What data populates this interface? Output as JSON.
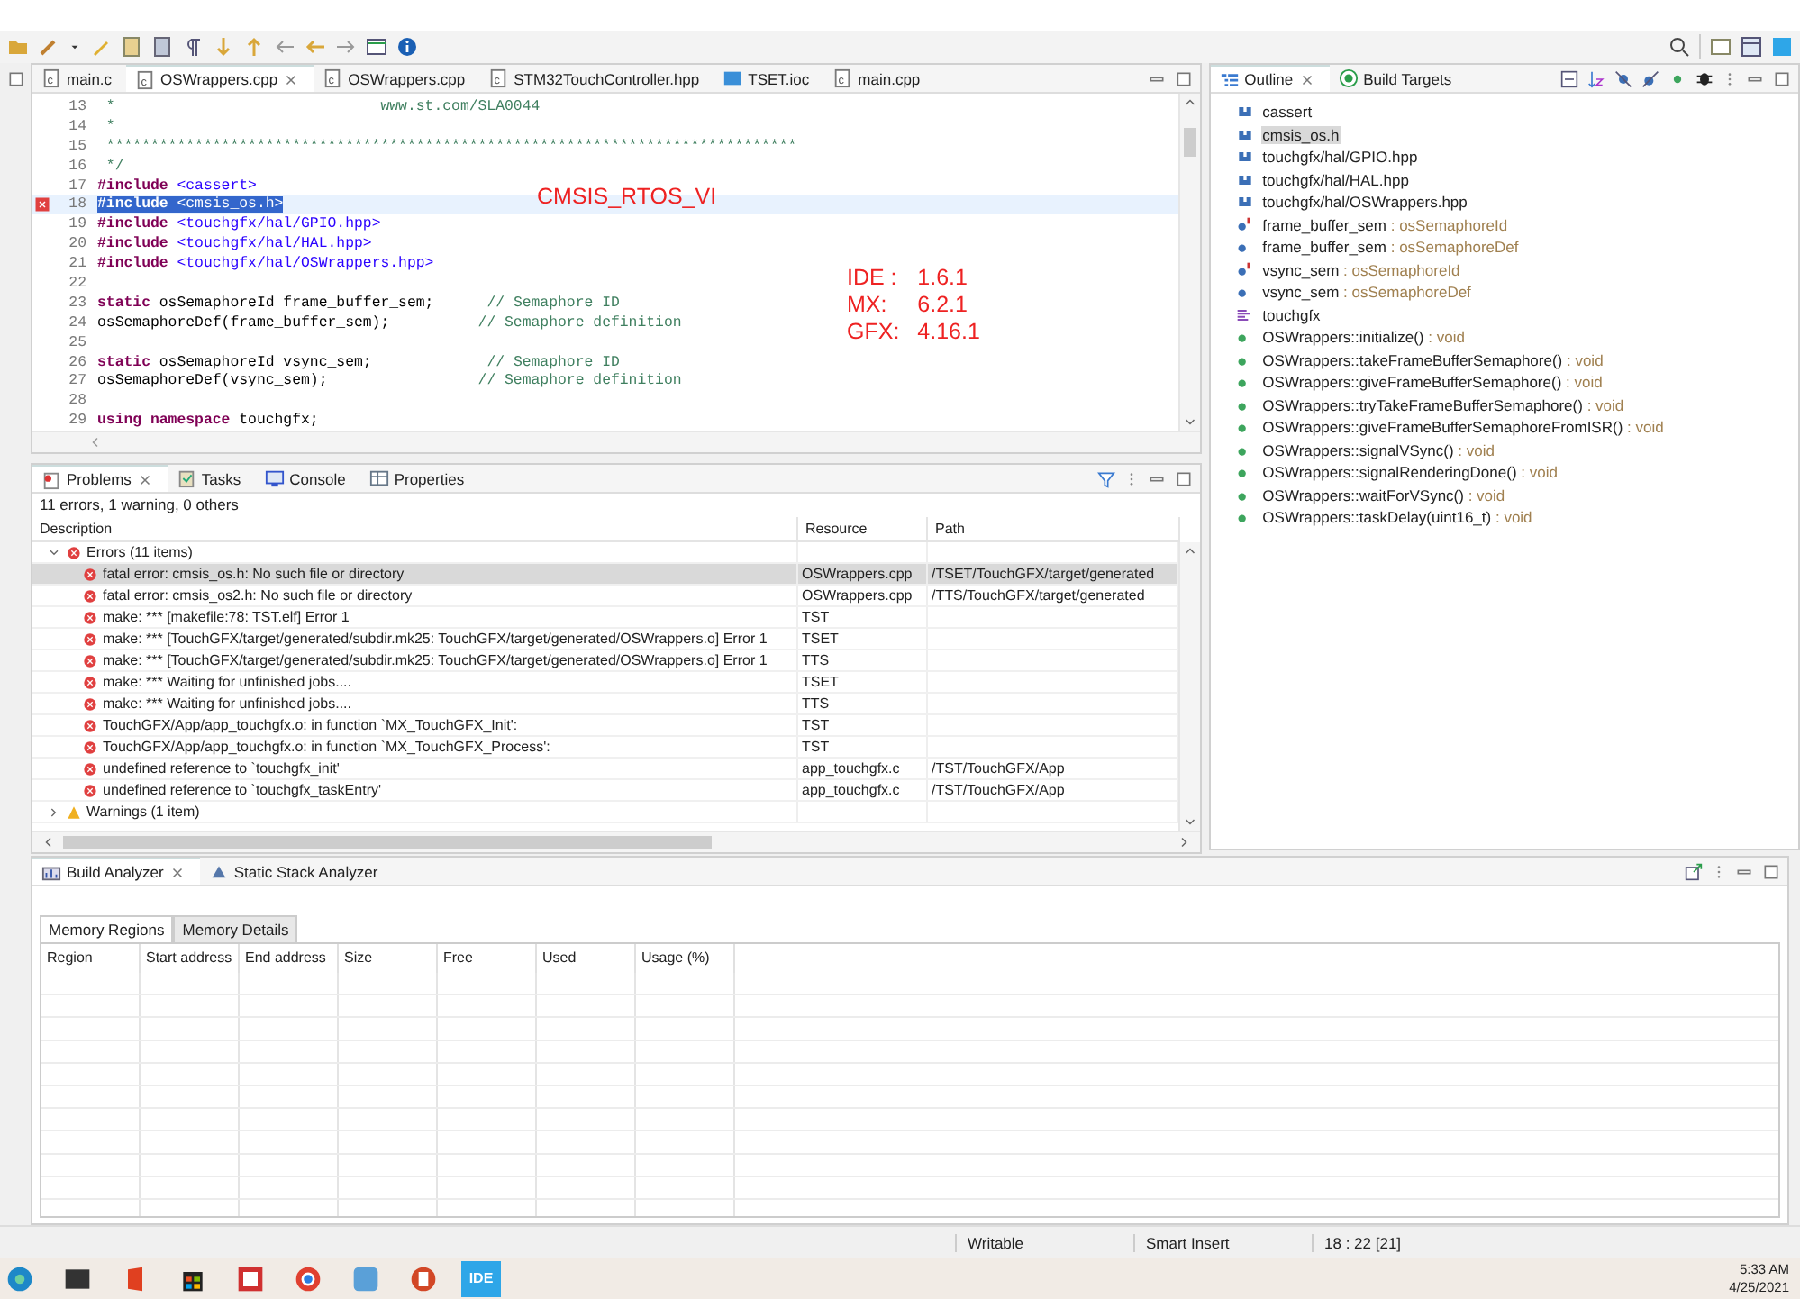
{
  "editor": {
    "tabs": [
      {
        "label": "main.c",
        "selected": false,
        "kind": "c"
      },
      {
        "label": "OSWrappers.cpp",
        "selected": true,
        "kind": "c"
      },
      {
        "label": "OSWrappers.cpp",
        "selected": false,
        "kind": "c"
      },
      {
        "label": "STM32TouchController.hpp",
        "selected": false,
        "kind": "c"
      },
      {
        "label": "TSET.ioc",
        "selected": false,
        "kind": "mx"
      },
      {
        "label": "main.cpp",
        "selected": false,
        "kind": "c"
      }
    ],
    "lines": [
      {
        "number": "13",
        "current": false,
        "error": false,
        "selected": false,
        "tokens": [
          {
            "kind": "comment",
            "text": " *                              www.st.com/SLA0044"
          }
        ]
      },
      {
        "number": "14",
        "current": false,
        "error": false,
        "selected": false,
        "tokens": [
          {
            "kind": "comment",
            "text": " *"
          }
        ]
      },
      {
        "number": "15",
        "current": false,
        "error": false,
        "selected": false,
        "tokens": [
          {
            "kind": "comment",
            "text": " ******************************************************************************"
          }
        ]
      },
      {
        "number": "16",
        "current": false,
        "error": false,
        "selected": false,
        "tokens": [
          {
            "kind": "comment",
            "text": " */"
          }
        ]
      },
      {
        "number": "17",
        "current": false,
        "error": false,
        "selected": false,
        "tokens": [
          {
            "kind": "keyword",
            "text": "#include"
          },
          {
            "kind": "string",
            "text": " <cassert>"
          }
        ]
      },
      {
        "number": "18",
        "current": true,
        "error": true,
        "selected": true,
        "tokens": [
          {
            "kind": "keyword",
            "text": "#include"
          },
          {
            "kind": "string",
            "text": " <cmsis_os.h>"
          }
        ]
      },
      {
        "number": "19",
        "current": false,
        "error": false,
        "selected": false,
        "tokens": [
          {
            "kind": "keyword",
            "text": "#include"
          },
          {
            "kind": "string",
            "text": " <touchgfx/hal/GPIO.hpp>"
          }
        ]
      },
      {
        "number": "20",
        "current": false,
        "error": false,
        "selected": false,
        "tokens": [
          {
            "kind": "keyword",
            "text": "#include"
          },
          {
            "kind": "string",
            "text": " <touchgfx/hal/HAL.hpp>"
          }
        ]
      },
      {
        "number": "21",
        "current": false,
        "error": false,
        "selected": false,
        "tokens": [
          {
            "kind": "keyword",
            "text": "#include"
          },
          {
            "kind": "string",
            "text": " <touchgfx/hal/OSWrappers.hpp>"
          }
        ]
      },
      {
        "number": "22",
        "current": false,
        "error": false
      },
      {
        "number": "23",
        "current": false,
        "error": false,
        "selected": false,
        "tokens": [
          {
            "kind": "keyword",
            "text": "static"
          },
          {
            "kind": "plain",
            "text": " osSemaphoreId frame_buffer_sem;      "
          },
          {
            "kind": "comment",
            "text": "// Semaphore ID"
          }
        ]
      },
      {
        "number": "24",
        "current": false,
        "error": false,
        "selected": false,
        "tokens": [
          {
            "kind": "plain",
            "text": "osSemaphoreDef(frame_buffer_sem);          "
          },
          {
            "kind": "comment",
            "text": "// Semaphore definition"
          }
        ]
      },
      {
        "number": "25",
        "current": false,
        "error": false
      },
      {
        "number": "26",
        "current": false,
        "error": false,
        "selected": false,
        "tokens": [
          {
            "kind": "keyword",
            "text": "static"
          },
          {
            "kind": "plain",
            "text": " osSemaphoreId vsync_sem;             "
          },
          {
            "kind": "comment",
            "text": "// Semaphore ID"
          }
        ]
      },
      {
        "number": "27",
        "current": false,
        "error": false,
        "selected": false,
        "tokens": [
          {
            "kind": "plain",
            "text": "osSemaphoreDef(vsync_sem);                 "
          },
          {
            "kind": "comment",
            "text": "// Semaphore definition"
          }
        ]
      },
      {
        "number": "28",
        "current": false,
        "error": false
      },
      {
        "number": "29",
        "current": false,
        "error": false,
        "selected": false,
        "tokens": [
          {
            "kind": "keyword",
            "text": "using namespace"
          },
          {
            "kind": "plain",
            "text": " touchgfx;"
          }
        ]
      }
    ],
    "annotation": "CMSIS_RTOS_VI",
    "versions": [
      {
        "label": "IDE :",
        "value": "1.6.1"
      },
      {
        "label": "MX:",
        "value": "6.2.1"
      },
      {
        "label": "GFX:",
        "value": "4.16.1"
      }
    ]
  },
  "problems": {
    "tabs": [
      {
        "label": "Problems",
        "selected": true,
        "kind": "problems"
      },
      {
        "label": "Tasks",
        "selected": false,
        "kind": "tasks"
      },
      {
        "label": "Console",
        "selected": false,
        "kind": "console"
      },
      {
        "label": "Properties",
        "selected": false,
        "kind": "properties"
      }
    ],
    "summary": "11 errors, 1 warning, 0 others",
    "columns": [
      "Description",
      "Resource",
      "Path"
    ],
    "groups": [
      {
        "label": "Errors (11 items)",
        "kind": "error",
        "expanded": true,
        "children": [
          {
            "description": "fatal error: cmsis_os.h: No such file or directory",
            "resource": "OSWrappers.cpp",
            "path": "/TSET/TouchGFX/target/generated",
            "selected": true
          },
          {
            "description": "fatal error: cmsis_os2.h: No such file or directory",
            "resource": "OSWrappers.cpp",
            "path": "/TTS/TouchGFX/target/generated",
            "selected": false
          },
          {
            "description": "make: *** [makefile:78: TST.elf] Error 1",
            "resource": "TST",
            "selected": false
          },
          {
            "description": "make: *** [TouchGFX/target/generated/subdir.mk25: TouchGFX/target/generated/OSWrappers.o] Error 1",
            "resource": "TSET",
            "selected": false
          },
          {
            "description": "make: *** [TouchGFX/target/generated/subdir.mk25: TouchGFX/target/generated/OSWrappers.o] Error 1",
            "resource": "TTS",
            "selected": false
          },
          {
            "description": "make: *** Waiting for unfinished jobs....",
            "resource": "TSET",
            "selected": false
          },
          {
            "description": "make: *** Waiting for unfinished jobs....",
            "resource": "TTS",
            "selected": false
          },
          {
            "description": "TouchGFX/App/app_touchgfx.o: in function `MX_TouchGFX_Init':",
            "resource": "TST",
            "selected": false
          },
          {
            "description": "TouchGFX/App/app_touchgfx.o: in function `MX_TouchGFX_Process':",
            "resource": "TST",
            "selected": false
          },
          {
            "description": "undefined reference to `touchgfx_init'",
            "resource": "app_touchgfx.c",
            "path": "/TST/TouchGFX/App",
            "selected": false
          },
          {
            "description": "undefined reference to `touchgfx_taskEntry'",
            "resource": "app_touchgfx.c",
            "path": "/TST/TouchGFX/App",
            "selected": false
          }
        ]
      },
      {
        "label": "Warnings (1 item)",
        "kind": "warning",
        "expanded": false
      }
    ]
  },
  "outline": {
    "tabs": [
      {
        "label": "Outline",
        "selected": true,
        "kind": "outline"
      },
      {
        "label": "Build Targets",
        "selected": false,
        "kind": "targets"
      }
    ],
    "items": [
      {
        "kind": "include",
        "name": "cassert",
        "selected": false
      },
      {
        "kind": "include",
        "name": "cmsis_os.h",
        "selected": true
      },
      {
        "kind": "include",
        "name": "touchgfx/hal/GPIO.hpp",
        "selected": false
      },
      {
        "kind": "include",
        "name": "touchgfx/hal/HAL.hpp",
        "selected": false
      },
      {
        "kind": "include",
        "name": "touchgfx/hal/OSWrappers.hpp",
        "selected": false
      },
      {
        "kind": "static-field",
        "name": "frame_buffer_sem",
        "type": " : osSemaphoreId",
        "selected": false
      },
      {
        "kind": "field",
        "name": "frame_buffer_sem",
        "type": " : osSemaphoreDef",
        "selected": false
      },
      {
        "kind": "static-field",
        "name": "vsync_sem",
        "type": " : osSemaphoreId",
        "selected": false
      },
      {
        "kind": "field",
        "name": "vsync_sem",
        "type": " : osSemaphoreDef",
        "selected": false
      },
      {
        "kind": "namespace",
        "name": "touchgfx",
        "selected": false
      },
      {
        "kind": "method",
        "name": "OSWrappers::initialize()",
        "type": " : void",
        "selected": false
      },
      {
        "kind": "method",
        "name": "OSWrappers::takeFrameBufferSemaphore()",
        "type": " : void",
        "selected": false
      },
      {
        "kind": "method",
        "name": "OSWrappers::giveFrameBufferSemaphore()",
        "type": " : void",
        "selected": false
      },
      {
        "kind": "method",
        "name": "OSWrappers::tryTakeFrameBufferSemaphore()",
        "type": " : void",
        "selected": false
      },
      {
        "kind": "method",
        "name": "OSWrappers::giveFrameBufferSemaphoreFromISR()",
        "type": " : void",
        "selected": false
      },
      {
        "kind": "method",
        "name": "OSWrappers::signalVSync()",
        "type": " : void",
        "selected": false
      },
      {
        "kind": "method",
        "name": "OSWrappers::signalRenderingDone()",
        "type": " : void",
        "selected": false
      },
      {
        "kind": "method",
        "name": "OSWrappers::waitForVSync()",
        "type": " : void",
        "selected": false
      },
      {
        "kind": "method",
        "name": "OSWrappers::taskDelay(uint16_t)",
        "type": " : void",
        "selected": false
      }
    ]
  },
  "build_analyzer": {
    "tabs": [
      {
        "label": "Build Analyzer",
        "selected": true,
        "kind": "build"
      },
      {
        "label": "Static Stack Analyzer",
        "selected": false,
        "kind": "stack"
      }
    ],
    "subtabs": [
      {
        "label": "Memory Regions",
        "selected": true
      },
      {
        "label": "Memory Details",
        "selected": false
      }
    ],
    "columns": [
      "Region",
      "Start address",
      "End address",
      "Size",
      "Free",
      "Used",
      "Usage (%)"
    ]
  },
  "status_bar": [
    "Writable",
    "Smart Insert",
    "18 : 22 [21]"
  ],
  "taskbar": {
    "app_label": "IDE",
    "time": "5:33 AM",
    "date": "4/25/2021"
  }
}
